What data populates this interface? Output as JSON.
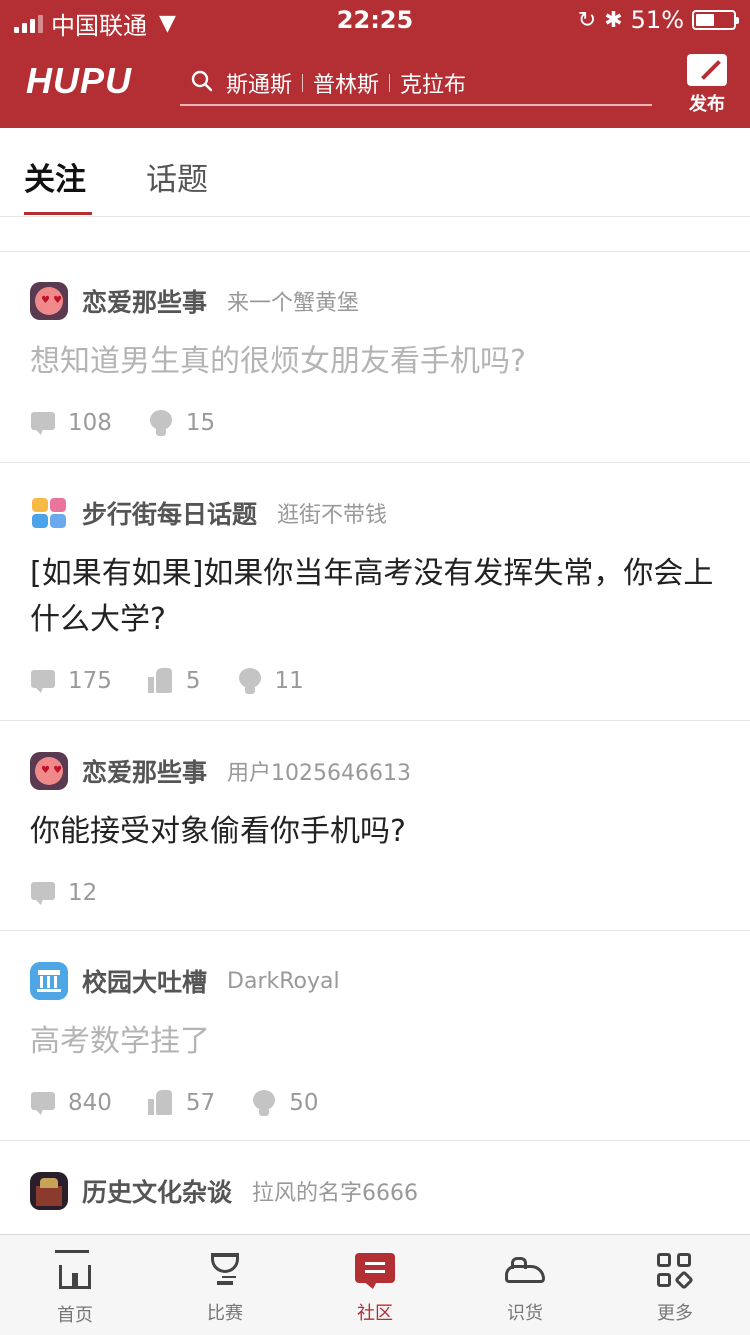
{
  "status_bar": {
    "carrier": "中国联通",
    "time": "22:25",
    "battery_percent": "51%",
    "battery_level": 0.51
  },
  "header": {
    "logo": "HUPU",
    "search_hints": [
      "斯通斯",
      "普林斯",
      "克拉布"
    ],
    "publish_label": "发布"
  },
  "tabs": [
    {
      "label": "关注",
      "active": true
    },
    {
      "label": "话题",
      "active": false
    }
  ],
  "posts": [
    {
      "board": "恋爱那些事",
      "author": "来一个蟹黄堡",
      "title": "想知道男生真的很烦女朋友看手机吗?",
      "read": true,
      "icon": "love-board-icon",
      "comments": "108",
      "likes": null,
      "lights": "15"
    },
    {
      "board": "步行街每日话题",
      "author": "逛街不带钱",
      "title": "[如果有如果]如果你当年高考没有发挥失常，你会上什么大学?",
      "read": false,
      "icon": "daily-topic-icon",
      "comments": "175",
      "likes": "5",
      "lights": "11"
    },
    {
      "board": "恋爱那些事",
      "author": "用户1025646613",
      "title": "你能接受对象偷看你手机吗?",
      "read": false,
      "icon": "love-board-icon",
      "comments": "12",
      "likes": null,
      "lights": null
    },
    {
      "board": "校园大吐槽",
      "author": "DarkRoyal",
      "title": "高考数学挂了",
      "read": true,
      "icon": "campus-building-icon",
      "comments": "840",
      "likes": "57",
      "lights": "50"
    },
    {
      "board": "历史文化杂谈",
      "author": "拉风的名字6666",
      "title": "",
      "read": false,
      "icon": "history-culture-icon",
      "comments": null,
      "likes": null,
      "lights": null
    }
  ],
  "tabbar": [
    {
      "label": "首页",
      "icon": "home-icon",
      "active": false
    },
    {
      "label": "比赛",
      "icon": "trophy-icon",
      "active": false
    },
    {
      "label": "社区",
      "icon": "community-chat-icon",
      "active": true
    },
    {
      "label": "识货",
      "icon": "sneaker-icon",
      "active": false
    },
    {
      "label": "更多",
      "icon": "more-grid-icon",
      "active": false
    }
  ],
  "colors": {
    "brand": "#b42f34",
    "read_title": "#b4b4b4",
    "meta": "#9a9a9a"
  }
}
